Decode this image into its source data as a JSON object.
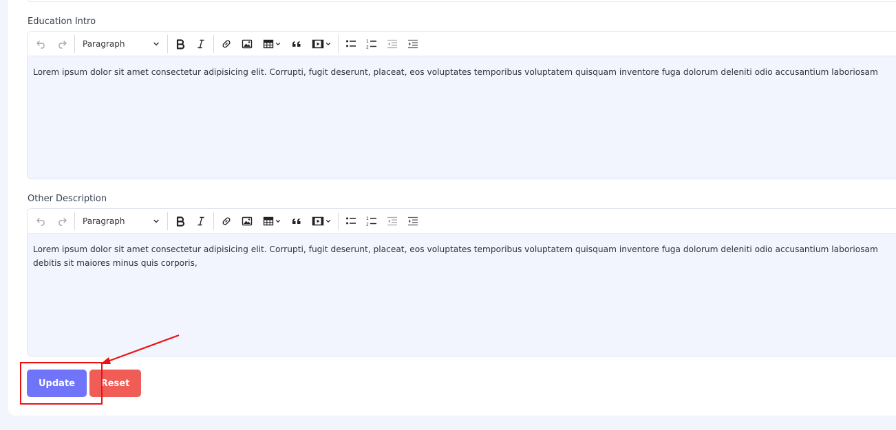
{
  "editors": [
    {
      "label": "Education Intro",
      "format_select": "Paragraph",
      "content_lines": [
        "Lorem ipsum dolor sit amet consectetur adipisicing elit. Corrupti, fugit deserunt, placeat, eos voluptates temporibus voluptatem quisquam inventore fuga dolorum deleniti odio accusantium laboriosam"
      ]
    },
    {
      "label": "Other Description",
      "format_select": "Paragraph",
      "content_lines": [
        "Lorem ipsum dolor sit amet consectetur adipisicing elit. Corrupti, fugit deserunt, placeat, eos voluptates temporibus voluptatem quisquam inventore fuga dolorum deleniti odio accusantium laboriosam",
        "debitis sit maiores minus quis corporis,"
      ]
    }
  ],
  "actions": {
    "update_label": "Update",
    "reset_label": "Reset"
  },
  "toolbar_icons": [
    "undo-icon",
    "redo-icon",
    "bold-icon",
    "italic-icon",
    "link-icon",
    "image-icon",
    "table-icon",
    "blockquote-icon",
    "media-embed-icon",
    "bulleted-list-icon",
    "numbered-list-icon",
    "outdent-icon",
    "indent-icon"
  ],
  "colors": {
    "update_button": "#6f74f8",
    "reset_button": "#f05d57",
    "annotation": "#ee1111",
    "editor_content_bg": "#f2f5fd"
  }
}
